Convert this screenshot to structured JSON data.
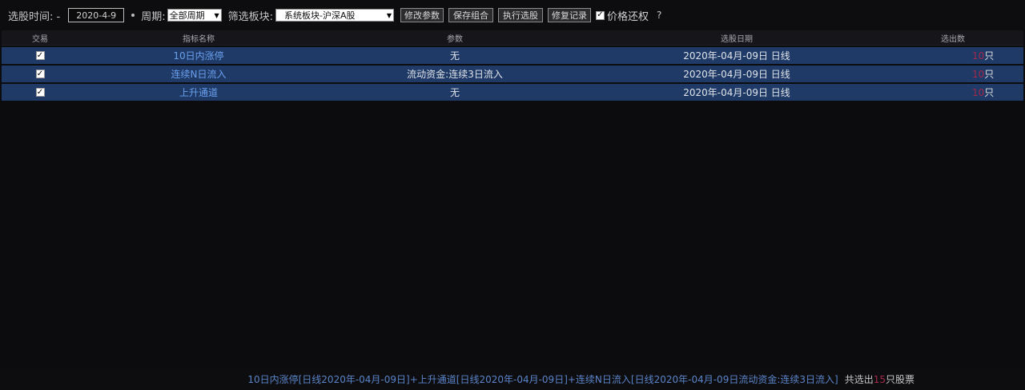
{
  "toolbar": {
    "time_label": "选股时间: -",
    "date_value": "2020-4-9",
    "period_label": "周期:",
    "period_value": "全部周期",
    "block_label": "筛选板块:",
    "block_value": "系统板块-沪深A股",
    "buttons": {
      "modify_params": "修改参数",
      "save_combo": "保存组合",
      "run_select": "执行选股",
      "restore_record": "修复记录"
    },
    "price_restore_label": "价格还权",
    "price_restore_checked": "✓",
    "help": "?"
  },
  "table": {
    "headers": {
      "trade": "交易",
      "name": "指标名称",
      "param": "参数",
      "date": "选股日期",
      "result": "选出数"
    },
    "rows": [
      {
        "checked": "✓",
        "name": "10日内涨停",
        "param": "无",
        "date": "2020年-04月-09日 日线",
        "count": "10",
        "unit": "只"
      },
      {
        "checked": "✓",
        "name": "连续N日流入",
        "param": "流动资金:连续3日流入",
        "date": "2020年-04月-09日 日线",
        "count": "10",
        "unit": "只"
      },
      {
        "checked": "✓",
        "name": "上升通道",
        "param": "无",
        "date": "2020年-04月-09日 日线",
        "count": "10",
        "unit": "只"
      }
    ]
  },
  "footer": {
    "summary": "10日内涨停[日线2020年-04月-09日]+上升通道[日线2020年-04月-09日]+连续N日流入[日线2020年-04月-09日流动资金:连续3日流入]",
    "total_prefix": "共选出",
    "total_count": "15",
    "total_suffix": "只股票"
  },
  "colors": {
    "row_bg": "#1f3a66",
    "name_link": "#6aa0ee",
    "count_red": "#a22a4a",
    "background": "#0c0c0e"
  }
}
